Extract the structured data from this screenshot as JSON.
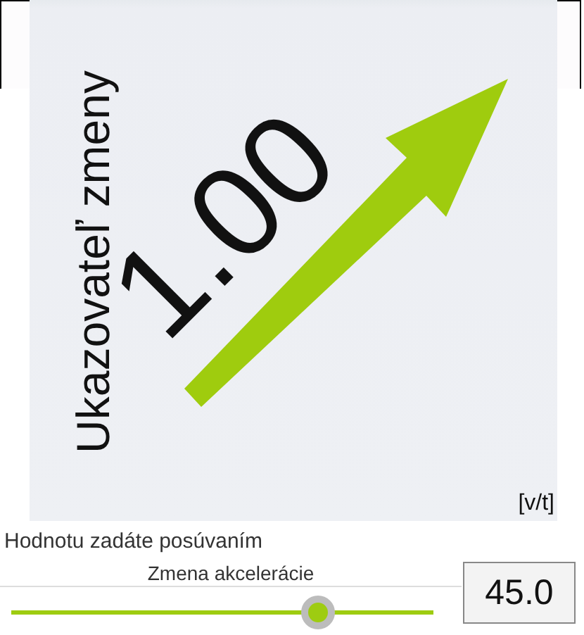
{
  "gauge": {
    "title": "Ukazovateľ zmeny",
    "value": "1.00",
    "unit": "[v/t]"
  },
  "instruction": "Hodnotu zadáte posúvaním",
  "slider": {
    "label": "Zmena akcelerácie",
    "level": 0.727
  },
  "value_field": {
    "value": "45.0"
  }
}
